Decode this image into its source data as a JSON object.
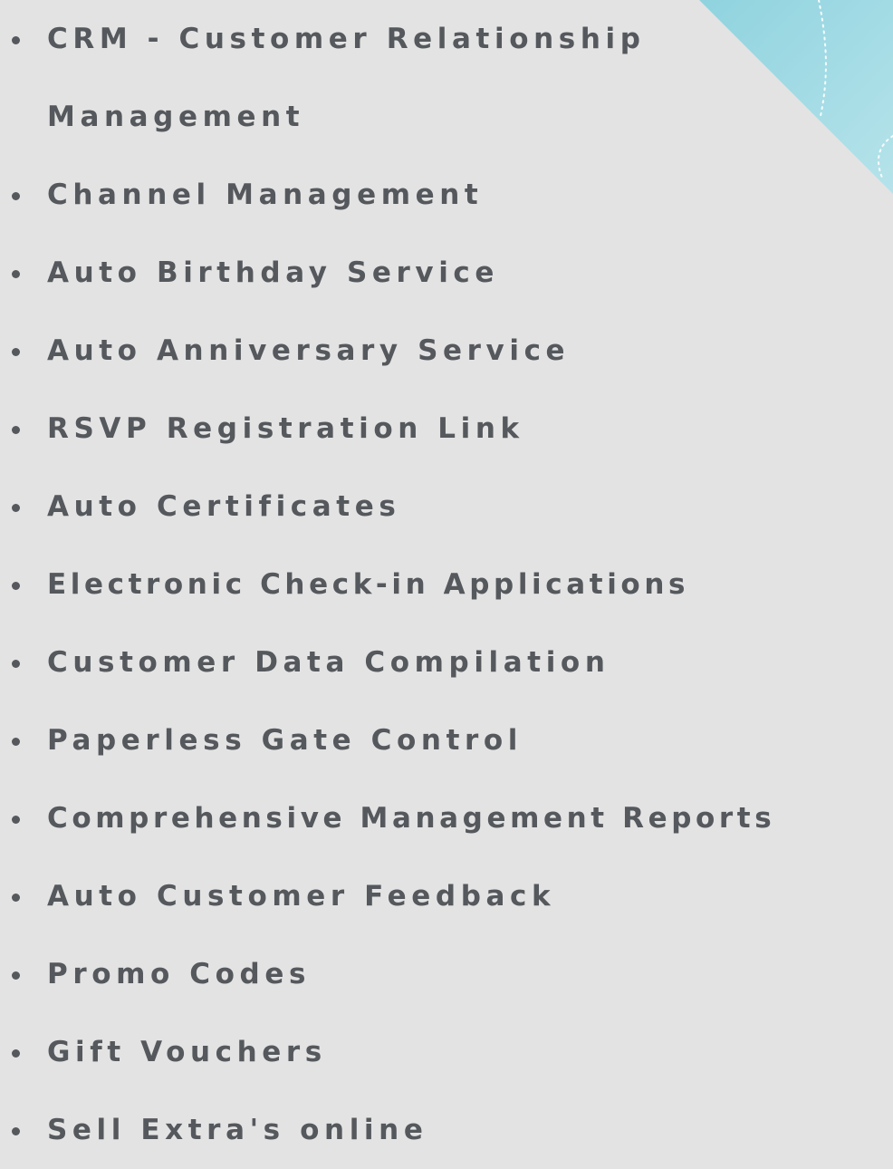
{
  "features": [
    {
      "label": "CRM - Customer Relationship Management"
    },
    {
      "label": "Channel Management"
    },
    {
      "label": "Auto Birthday Service"
    },
    {
      "label": "Auto Anniversary Service"
    },
    {
      "label": "RSVP Registration Link"
    },
    {
      "label": "Auto Certificates"
    },
    {
      "label": "Electronic Check-in Applications"
    },
    {
      "label": "Customer Data Compilation"
    },
    {
      "label": "Paperless Gate Control"
    },
    {
      "label": "Comprehensive Management Reports"
    },
    {
      "label": "Auto Customer Feedback"
    },
    {
      "label": "Promo Codes"
    },
    {
      "label": "Gift Vouchers"
    },
    {
      "label": "Sell Extra's online"
    }
  ],
  "colors": {
    "background": "#e3e3e3",
    "text": "#55585c",
    "accent": "#a9dde6"
  }
}
